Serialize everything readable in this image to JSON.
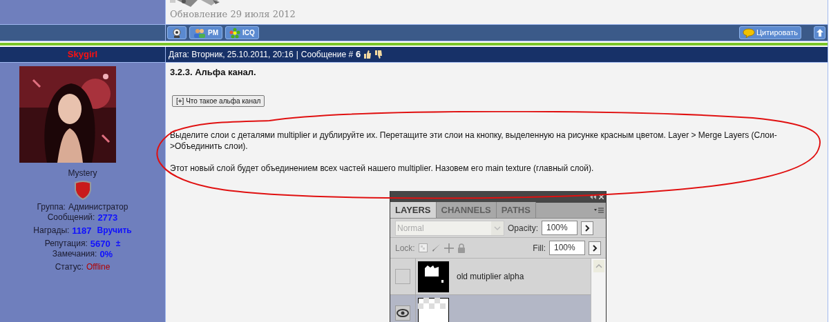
{
  "top_row": {
    "update_text": "Обновление 29 июля 2012"
  },
  "toolbar": {
    "buttons": [
      {
        "kind": "webcam"
      },
      {
        "kind": "pm",
        "label": "PM"
      },
      {
        "kind": "icq",
        "label": "ICQ"
      }
    ],
    "quote_button": "Цитировать"
  },
  "post_header": {
    "author": "Skygirl",
    "date_label": "Дата: Вторник, 25.10.2011, 20:16",
    "separator": "|",
    "message_label": "Сообщение #",
    "message_number": "6"
  },
  "profile": {
    "rank": "Mystery",
    "stats": [
      {
        "label": "Группа:",
        "value": "Администратор",
        "kind": "plain"
      },
      {
        "label": "Сообщений:",
        "value": "2773",
        "kind": "number"
      },
      {
        "label": "Награды:",
        "value": "1187",
        "extra": "Вручить",
        "kind": "number"
      },
      {
        "label": "Репутация:",
        "value": "5670",
        "extra": "±",
        "kind": "number"
      },
      {
        "label": "Замечания:",
        "value": "0%",
        "kind": "number"
      },
      {
        "label": "Статус:",
        "value": "Offline",
        "kind": "status"
      }
    ]
  },
  "post": {
    "title": "3.2.3. Альфа канал.",
    "spoiler_button": "[+] Что такое альфа канал",
    "paragraphs": [
      "Выделите слои с деталями multiplier и дублируйте их. Перетащите эти слои на кнопку, выделенную на рисунке красным цветом. Layer > Merge Layers (Слои->Объединить слои).",
      "Этот новый слой будет объединением всех частей нашего multiplier. Назовем его main texture (главный слой)."
    ]
  },
  "layers_panel": {
    "tabs": [
      {
        "label": "LAYERS",
        "selected": true
      },
      {
        "label": "CHANNELS",
        "selected": false
      },
      {
        "label": "PATHS",
        "selected": false
      }
    ],
    "blend_mode": "Normal",
    "opacity_label": "Opacity:",
    "opacity": "100%",
    "lock_label": "Lock:",
    "fill_label": "Fill:",
    "fill": "100%",
    "layers": [
      {
        "name": "old mutiplier alpha",
        "visible": false,
        "selected": false,
        "kind": "mask"
      },
      {
        "visible": true,
        "selected": true,
        "kind": "transparent"
      }
    ]
  }
}
